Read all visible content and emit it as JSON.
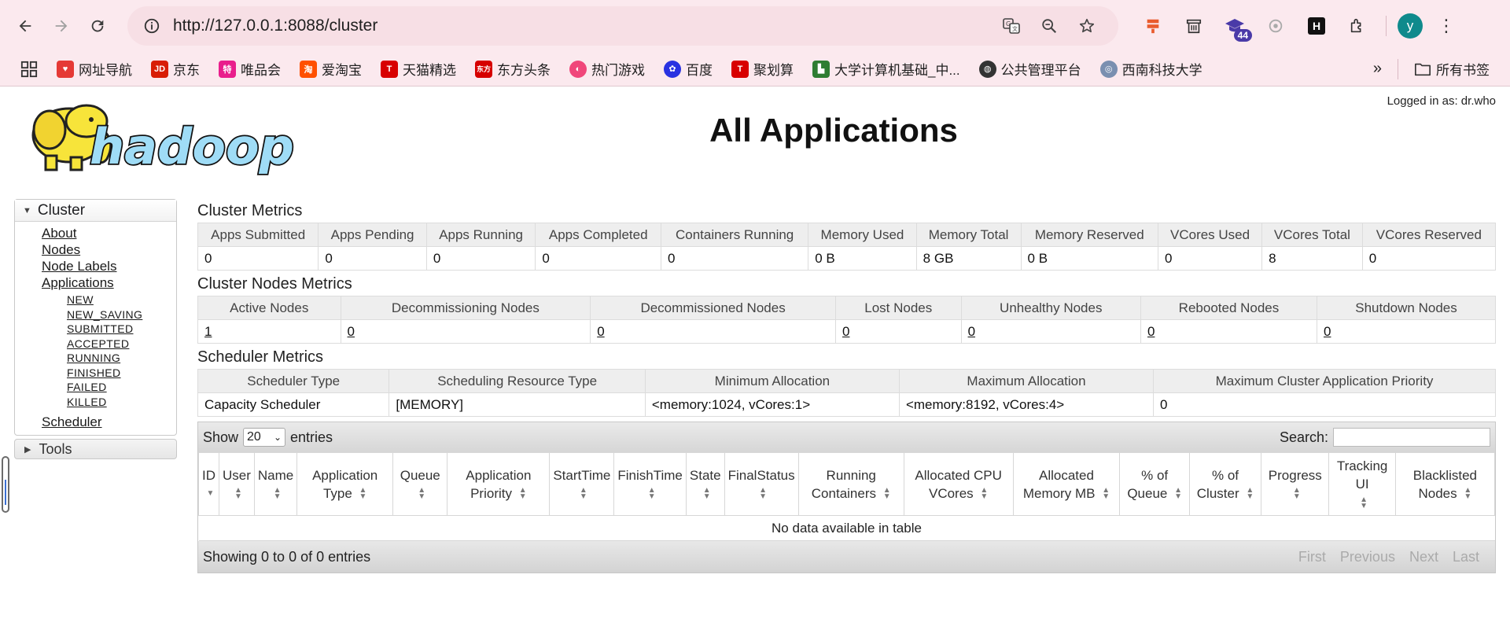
{
  "browser": {
    "url": "http://127.0.0.1:8088/cluster",
    "extension_badge": "44",
    "profile_initial": "y",
    "bookmarks": [
      {
        "label": "网址导航",
        "icon_color": "#e53935",
        "icon": "red-heart-icon"
      },
      {
        "label": "京东",
        "icon_color": "#d81e06",
        "icon": "jd-icon",
        "glyph": "JD"
      },
      {
        "label": "唯品会",
        "icon_color": "#e91e8c",
        "icon": "vip-icon",
        "glyph": "特"
      },
      {
        "label": "爱淘宝",
        "icon_color": "#ff5000",
        "icon": "taobao-icon",
        "glyph": "淘"
      },
      {
        "label": "天猫精选",
        "icon_color": "#d80000",
        "icon": "tmall-icon",
        "glyph": "T"
      },
      {
        "label": "东方头条",
        "icon_color": "#d60000",
        "icon": "toutiao-icon",
        "glyph": "东方"
      },
      {
        "label": "热门游戏",
        "icon_color": "#f0467a",
        "icon": "game-icon",
        "glyph": "◐"
      },
      {
        "label": "百度",
        "icon_color": "#2932e1",
        "icon": "baidu-icon",
        "glyph": "✿"
      },
      {
        "label": "聚划算",
        "icon_color": "#d80000",
        "icon": "juhuasuan-icon",
        "glyph": "T"
      },
      {
        "label": "大学计算机基础_中...",
        "icon_color": "#2e7d32",
        "icon": "book-icon",
        "glyph": "▙"
      },
      {
        "label": "公共管理平台",
        "icon_color": "#333333",
        "icon": "globe-icon",
        "glyph": "◍"
      },
      {
        "label": "西南科技大学",
        "icon_color": "#7a8fb0",
        "icon": "university-icon",
        "glyph": "◎"
      }
    ],
    "all_bookmarks_label": "所有书签"
  },
  "header": {
    "title": "All Applications",
    "logged_in": "Logged in as: dr.who"
  },
  "sidebar": {
    "cluster_label": "Cluster",
    "links": [
      "About",
      "Nodes",
      "Node Labels",
      "Applications"
    ],
    "app_states": [
      "NEW",
      "NEW_SAVING",
      "SUBMITTED",
      "ACCEPTED",
      "RUNNING",
      "FINISHED",
      "FAILED",
      "KILLED"
    ],
    "scheduler": "Scheduler",
    "tools_label": "Tools"
  },
  "cluster_metrics": {
    "title": "Cluster Metrics",
    "headers": [
      "Apps Submitted",
      "Apps Pending",
      "Apps Running",
      "Apps Completed",
      "Containers Running",
      "Memory Used",
      "Memory Total",
      "Memory Reserved",
      "VCores Used",
      "VCores Total",
      "VCores Reserved"
    ],
    "values": [
      "0",
      "0",
      "0",
      "0",
      "0",
      "0 B",
      "8 GB",
      "0 B",
      "0",
      "8",
      "0"
    ]
  },
  "nodes_metrics": {
    "title": "Cluster Nodes Metrics",
    "headers": [
      "Active Nodes",
      "Decommissioning Nodes",
      "Decommissioned Nodes",
      "Lost Nodes",
      "Unhealthy Nodes",
      "Rebooted Nodes",
      "Shutdown Nodes"
    ],
    "values": [
      "1",
      "0",
      "0",
      "0",
      "0",
      "0",
      "0"
    ]
  },
  "scheduler_metrics": {
    "title": "Scheduler Metrics",
    "headers": [
      "Scheduler Type",
      "Scheduling Resource Type",
      "Minimum Allocation",
      "Maximum Allocation",
      "Maximum Cluster Application Priority"
    ],
    "values": [
      "Capacity Scheduler",
      "[MEMORY]",
      "<memory:1024, vCores:1>",
      "<memory:8192, vCores:4>",
      "0"
    ]
  },
  "apps_table": {
    "show_label": "Show",
    "page_size": "20",
    "entries_label": "entries",
    "search_label": "Search:",
    "columns": [
      "ID",
      "User",
      "Name",
      "Application Type",
      "Queue",
      "Application Priority",
      "StartTime",
      "FinishTime",
      "State",
      "FinalStatus",
      "Running Containers",
      "Allocated CPU VCores",
      "Allocated Memory MB",
      "% of Queue",
      "% of Cluster",
      "Progress",
      "Tracking UI",
      "Blacklisted Nodes"
    ],
    "empty_message": "No data available in table",
    "info": "Showing 0 to 0 of 0 entries",
    "pager": [
      "First",
      "Previous",
      "Next",
      "Last"
    ]
  }
}
